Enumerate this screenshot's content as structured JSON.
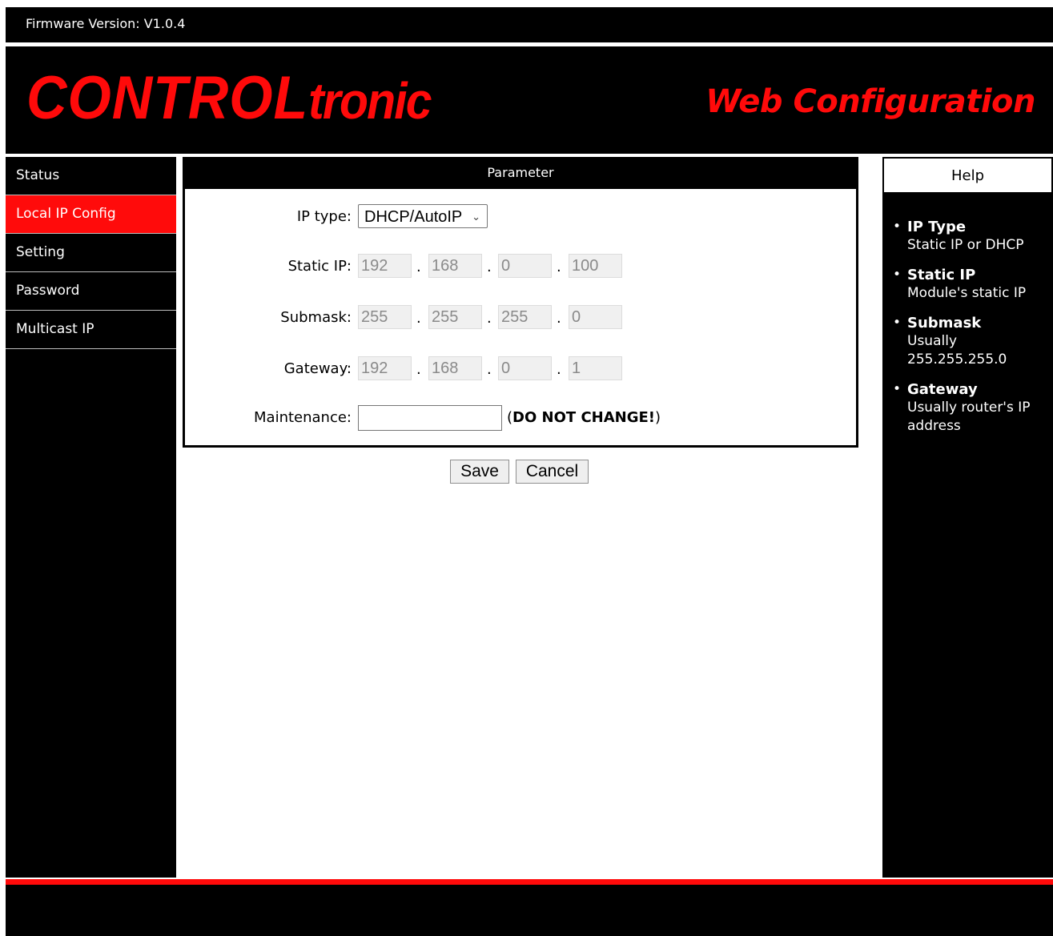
{
  "firmware": "Firmware Version: V1.0.4",
  "logo": {
    "part_a": "CONTROL",
    "part_b": "tronic"
  },
  "header_title": "Web Configuration",
  "nav": {
    "items": [
      {
        "label": "Status"
      },
      {
        "label": "Local IP Config",
        "active": true
      },
      {
        "label": "Setting"
      },
      {
        "label": "Password"
      },
      {
        "label": "Multicast IP"
      }
    ]
  },
  "panel": {
    "title": "Parameter",
    "ip_type": {
      "label": "IP type:",
      "value": "DHCP/AutoIP"
    },
    "static_ip": {
      "label": "Static IP:",
      "octets": [
        "192",
        "168",
        "0",
        "100"
      ]
    },
    "submask": {
      "label": "Submask:",
      "octets": [
        "255",
        "255",
        "255",
        "0"
      ]
    },
    "gateway": {
      "label": "Gateway:",
      "octets": [
        "192",
        "168",
        "0",
        "1"
      ]
    },
    "maintenance": {
      "label": "Maintenance:",
      "value": "",
      "note_open": "(",
      "note": "DO NOT CHANGE!",
      "note_close": ")"
    }
  },
  "buttons": {
    "save": "Save",
    "cancel": "Cancel"
  },
  "help": {
    "title": "Help",
    "items": [
      {
        "title": "IP Type",
        "text": "Static IP or DHCP"
      },
      {
        "title": "Static IP",
        "text": "Module's static IP"
      },
      {
        "title": "Submask",
        "text": "Usually 255.255.255.0"
      },
      {
        "title": "Gateway",
        "text": "Usually router's IP address"
      }
    ]
  },
  "colors": {
    "accent": "#ff0a0a",
    "background": "#000000"
  }
}
